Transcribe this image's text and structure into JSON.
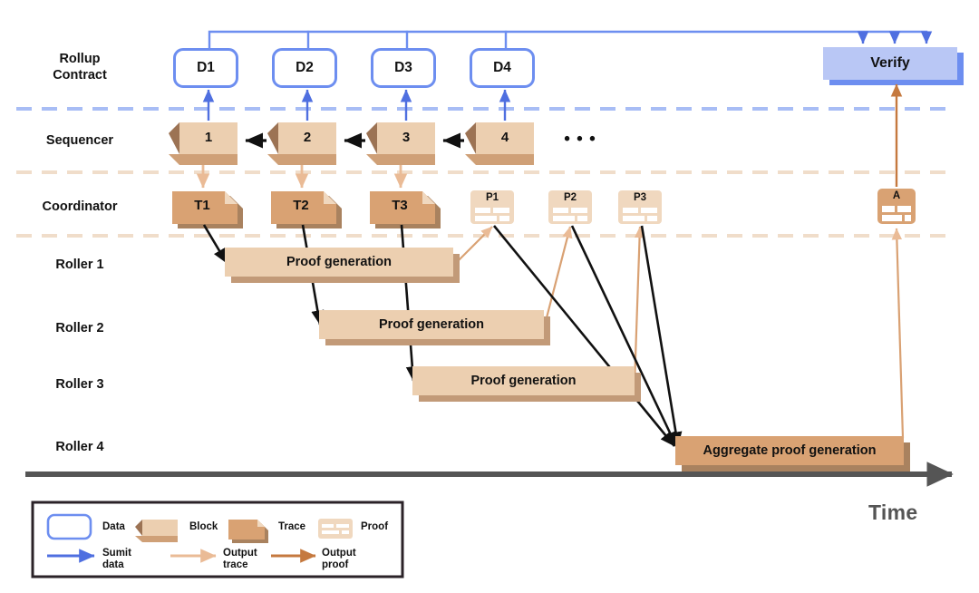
{
  "diagram": {
    "title_visible": false,
    "time_axis_label": "Time",
    "ellipsis": "• • •",
    "lanes": [
      {
        "id": "rollup-contract",
        "label": "Rollup\nContract",
        "line1": "Rollup",
        "line2": "Contract"
      },
      {
        "id": "sequencer",
        "label": "Sequencer"
      },
      {
        "id": "coordinator",
        "label": "Coordinator"
      },
      {
        "id": "roller-1",
        "label": "Roller 1"
      },
      {
        "id": "roller-2",
        "label": "Roller 2"
      },
      {
        "id": "roller-3",
        "label": "Roller 3"
      },
      {
        "id": "roller-4",
        "label": "Roller 4"
      }
    ],
    "data_nodes": [
      {
        "id": "d1",
        "label": "D1"
      },
      {
        "id": "d2",
        "label": "D2"
      },
      {
        "id": "d3",
        "label": "D3"
      },
      {
        "id": "d4",
        "label": "D4"
      }
    ],
    "verify_node": {
      "id": "verify",
      "label": "Verify"
    },
    "blocks": [
      {
        "id": "block-1",
        "label": "1"
      },
      {
        "id": "block-2",
        "label": "2"
      },
      {
        "id": "block-3",
        "label": "3"
      },
      {
        "id": "block-4",
        "label": "4"
      }
    ],
    "traces": [
      {
        "id": "trace-t1",
        "label": "T1"
      },
      {
        "id": "trace-t2",
        "label": "T2"
      },
      {
        "id": "trace-t3",
        "label": "T3"
      }
    ],
    "proofs": [
      {
        "id": "proof-p1",
        "label": "P1"
      },
      {
        "id": "proof-p2",
        "label": "P2"
      },
      {
        "id": "proof-p3",
        "label": "P3"
      }
    ],
    "aggregate_proof": {
      "id": "proof-a",
      "label": "A"
    },
    "tasks": [
      {
        "id": "task-roller-1",
        "label": "Proof generation",
        "lane": "roller-1"
      },
      {
        "id": "task-roller-2",
        "label": "Proof generation",
        "lane": "roller-2"
      },
      {
        "id": "task-roller-3",
        "label": "Proof generation",
        "lane": "roller-3"
      },
      {
        "id": "task-roller-4",
        "label": "Aggregate proof generation",
        "lane": "roller-4"
      }
    ]
  },
  "legend": {
    "shapes": [
      {
        "id": "legend-data",
        "label": "Data",
        "icon": "rounded-rect-outline"
      },
      {
        "id": "legend-block",
        "label": "Block",
        "icon": "cube-3d"
      },
      {
        "id": "legend-trace",
        "label": "Trace",
        "icon": "document-folded-corner"
      },
      {
        "id": "legend-proof",
        "label": "Proof",
        "icon": "proof-card"
      }
    ],
    "arrows": [
      {
        "id": "legend-submit-data",
        "line1": "Sumit",
        "line2": "data",
        "color": "#4f6fe0"
      },
      {
        "id": "legend-output-trace",
        "line1": "Output",
        "line2": "trace",
        "color": "#eabb96"
      },
      {
        "id": "legend-output-proof",
        "line1": "Output",
        "line2": "proof",
        "color": "#c5793f"
      }
    ]
  },
  "colors": {
    "data_border": "#6d8ef0",
    "verify_fill": "#b9c7f5",
    "verify_shadow": "#6d8ef0",
    "block_fill": "#eccfb0",
    "block_side": "#9c7354",
    "block_bottom": "#cfa077",
    "trace_fill": "#d9a273",
    "trace_shadow": "#a9825f",
    "proof_fill": "#f0d8bf",
    "bar_fill": "#eccfb0",
    "bar_shadow": "#c29a78",
    "agg_fill": "#d9a273",
    "agg_shadow": "#a9825f",
    "submit_arrow": "#4f6fe0",
    "trace_arrow": "#eabb96",
    "proof_arrow": "#c5793f",
    "black_arrow": "#111111",
    "time_axis": "#555555",
    "lane_divider_blue": "#a8bdf5",
    "lane_divider_tan": "#f0ddca",
    "legend_border": "#2b2328"
  }
}
